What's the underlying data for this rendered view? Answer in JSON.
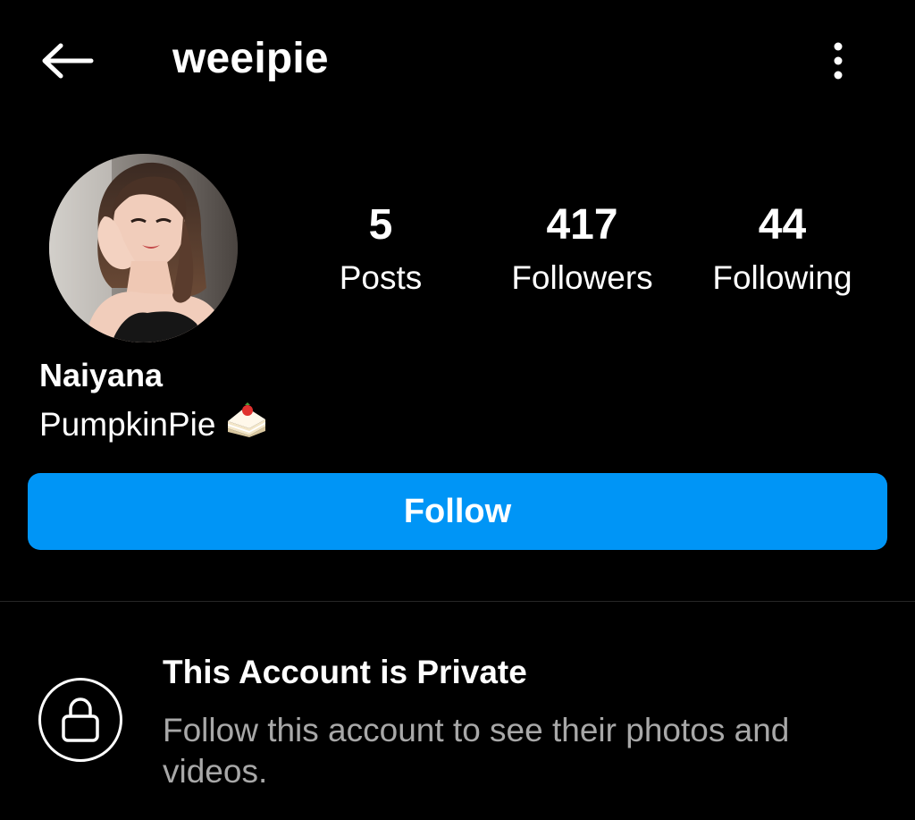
{
  "header": {
    "username": "weeipie",
    "back_icon": "arrow-left-icon",
    "more_icon": "more-vertical-icon"
  },
  "profile": {
    "avatar_icon": "profile-photo",
    "stats": [
      {
        "value": "5",
        "label": "Posts"
      },
      {
        "value": "417",
        "label": "Followers"
      },
      {
        "value": "44",
        "label": "Following"
      }
    ],
    "display_name": "Naiyana",
    "bio": "PumpkinPie",
    "bio_emoji": "shortcake-icon"
  },
  "actions": {
    "follow_label": "Follow",
    "follow_color": "#0095f6"
  },
  "private_notice": {
    "icon": "lock-icon",
    "title": "This Account is Private",
    "description": "Follow this account to see their photos and videos."
  }
}
